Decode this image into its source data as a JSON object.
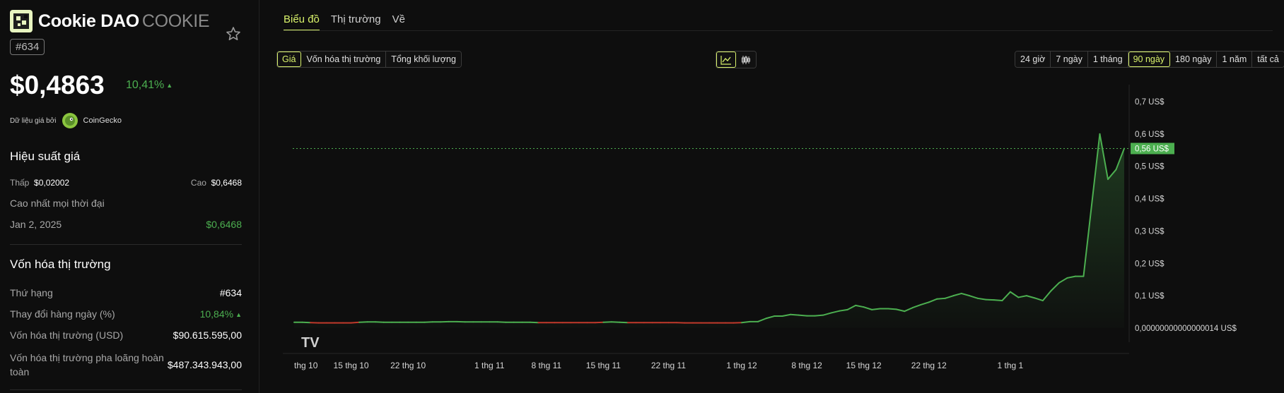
{
  "coin": {
    "name": "Cookie DAO",
    "symbol": "COOKIE",
    "rank_badge": "#634",
    "price": "$0,4863",
    "change_24h": "10,41%",
    "data_source_label": "Dữ liệu giá bởi",
    "data_source_name": "CoinGecko"
  },
  "performance": {
    "title": "Hiệu suất giá",
    "low_label": "Thấp",
    "low_value": "$0,02002",
    "high_label": "Cao",
    "high_value": "$0,6468",
    "ath_label": "Cao nhất mọi thời đại",
    "ath_date": "Jan 2, 2025",
    "ath_value": "$0,6468"
  },
  "market_cap": {
    "title": "Vốn hóa thị trường",
    "rows": [
      {
        "label": "Thứ hạng",
        "value": "#634"
      },
      {
        "label": "Thay đổi hàng ngày (%)",
        "value": "10,84%"
      },
      {
        "label": "Vốn hóa thị trường (USD)",
        "value": "$90.615.595,00"
      },
      {
        "label": "Vốn hóa thị trường pha loãng hoàn toàn",
        "value": "$487.343.943,00"
      }
    ]
  },
  "tabs": [
    "Biểu đồ",
    "Thị trường",
    "Về"
  ],
  "metric_buttons": [
    "Giá",
    "Vốn hóa thị trường",
    "Tổng khối lượng"
  ],
  "view_icons": [
    "line-chart-icon",
    "candlestick-icon"
  ],
  "range_buttons": [
    "24 giờ",
    "7 ngày",
    "1 tháng",
    "90 ngày",
    "180 ngày",
    "1 năm",
    "tất cả"
  ],
  "active_range": "90 ngày",
  "colors": {
    "accent": "#d9f26b",
    "up": "#4caf50",
    "down": "#c0392b",
    "background": "#0e0e0e"
  },
  "chart_data": {
    "type": "line",
    "x_tick_labels": [
      "thg 10",
      "15 thg 10",
      "22 thg 10",
      "1 thg 11",
      "8 thg 11",
      "15 thg 11",
      "22 thg 11",
      "1 thg 12",
      "8 thg 12",
      "15 thg 12",
      "22 thg 12",
      "1 thg 1"
    ],
    "y_tick_labels": [
      "0,7 US$",
      "0,6 US$",
      "0,5 US$",
      "0,4 US$",
      "0,3 US$",
      "0,2 US$",
      "0,1 US$",
      "0,00000000000000014 US$"
    ],
    "y_ticks": [
      0.7,
      0.6,
      0.5,
      0.4,
      0.3,
      0.2,
      0.1,
      0
    ],
    "ylim": [
      0,
      0.7
    ],
    "current_price_label": "0,56 US$",
    "current_price": 0.555,
    "watermark": "TV",
    "values": [
      0.018,
      0.018,
      0.017,
      0.016,
      0.016,
      0.016,
      0.016,
      0.016,
      0.018,
      0.019,
      0.019,
      0.018,
      0.018,
      0.018,
      0.018,
      0.018,
      0.018,
      0.019,
      0.019,
      0.02,
      0.02,
      0.019,
      0.019,
      0.019,
      0.019,
      0.019,
      0.018,
      0.018,
      0.018,
      0.018,
      0.017,
      0.017,
      0.017,
      0.017,
      0.017,
      0.017,
      0.017,
      0.017,
      0.018,
      0.019,
      0.018,
      0.017,
      0.017,
      0.017,
      0.017,
      0.017,
      0.017,
      0.017,
      0.016,
      0.016,
      0.016,
      0.016,
      0.016,
      0.016,
      0.016,
      0.017,
      0.02,
      0.02,
      0.03,
      0.037,
      0.037,
      0.042,
      0.04,
      0.038,
      0.038,
      0.04,
      0.047,
      0.053,
      0.057,
      0.07,
      0.065,
      0.057,
      0.06,
      0.06,
      0.058,
      0.052,
      0.063,
      0.072,
      0.08,
      0.09,
      0.092,
      0.1,
      0.107,
      0.1,
      0.092,
      0.088,
      0.087,
      0.085,
      0.112,
      0.095,
      0.1,
      0.093,
      0.085,
      0.115,
      0.14,
      0.155,
      0.16,
      0.16,
      0.38,
      0.6,
      0.46,
      0.49,
      0.555
    ]
  }
}
